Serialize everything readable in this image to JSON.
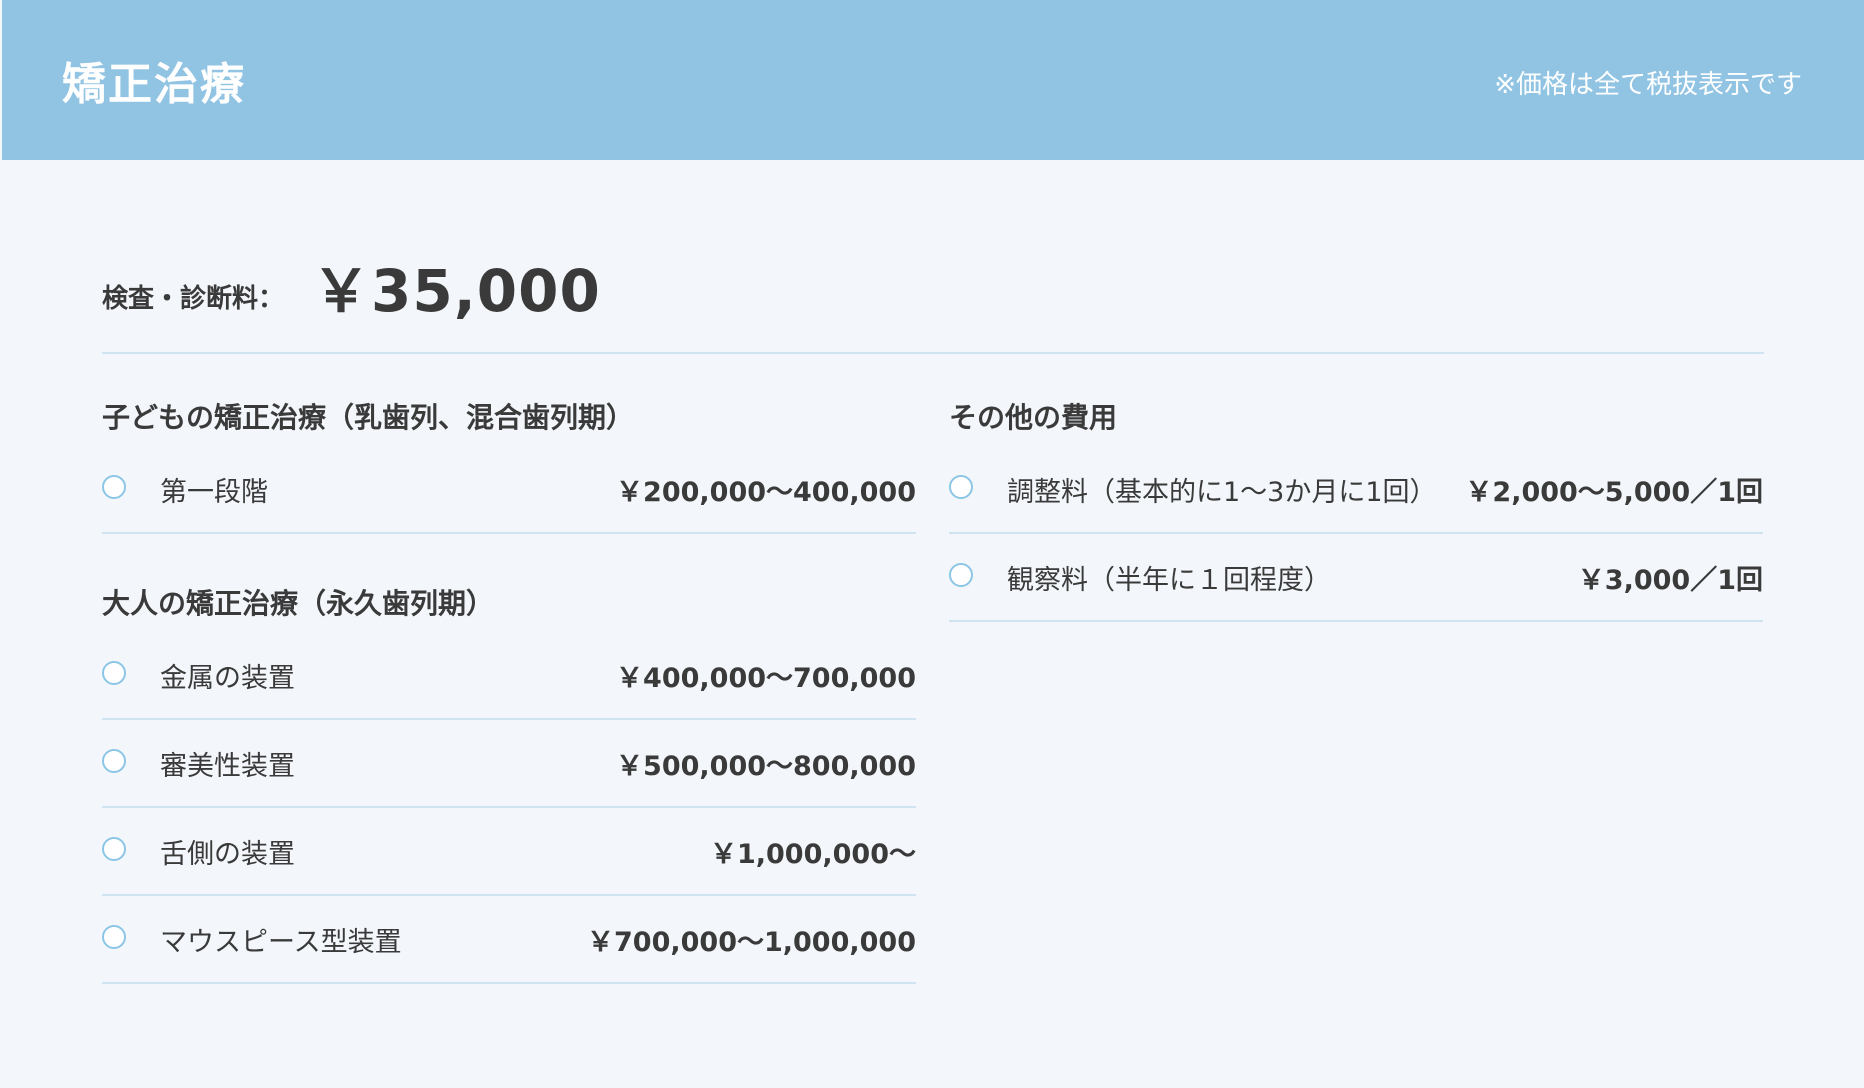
{
  "header": {
    "title": "矯正治療",
    "note": "※価格は全て税抜表示です"
  },
  "exam": {
    "label": "検査・診断料：",
    "price": "￥35,000"
  },
  "children": {
    "title": "子どもの矯正治療（乳歯列、混合歯列期）",
    "items": [
      {
        "label": "第一段階",
        "price": "￥200,000〜400,000"
      }
    ]
  },
  "adults": {
    "title": "大人の矯正治療（永久歯列期）",
    "items": [
      {
        "label": "金属の装置",
        "price": "￥400,000〜700,000"
      },
      {
        "label": "審美性装置",
        "price": "￥500,000〜800,000"
      },
      {
        "label": "舌側の装置",
        "price": "￥1,000,000〜"
      },
      {
        "label": "マウスピース型装置",
        "price": "￥700,000〜1,000,000"
      }
    ]
  },
  "other": {
    "title": "その他の費用",
    "items": [
      {
        "label": "調整料（基本的に1〜3か月に1回）",
        "price": "￥2,000〜5,000／1回"
      },
      {
        "label": "観察料（半年に１回程度）",
        "price": "￥3,000／1回"
      }
    ]
  },
  "colors": {
    "header_bg": "#91c4e3",
    "page_bg": "#f3f7fb",
    "divider": "#cfe3f1",
    "radio_border": "#8cc6e6",
    "text": "#3a3a3a"
  }
}
